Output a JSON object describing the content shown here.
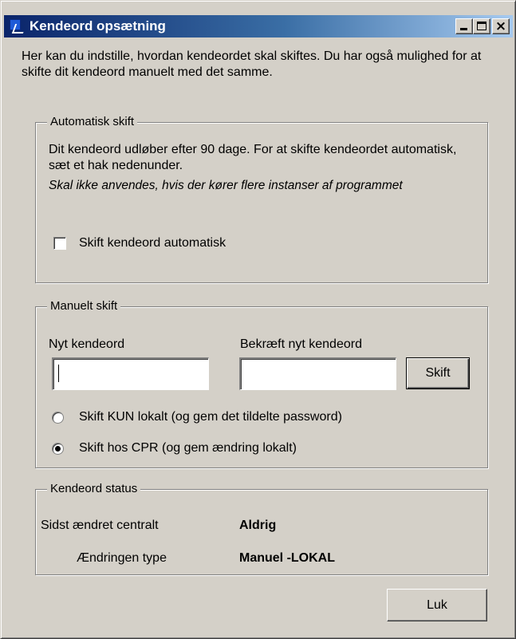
{
  "window": {
    "title": "Kendeord opsætning",
    "caption_minimize": "_",
    "caption_maximize": "□",
    "caption_close": "×"
  },
  "intro_text": "Her kan du indstille, hvordan kendeordet skal skiftes. Du har også mulighed for at skifte dit kendeord manuelt med det samme.",
  "automatic": {
    "legend": "Automatisk skift",
    "description": "Dit kendeord udløber efter 90 dage. For at skifte kendeordet automatisk, sæt et hak nedenunder.",
    "warning": "Skal ikke anvendes, hvis der kører flere instanser af programmet",
    "checkbox_label": "Skift kendeord automatisk",
    "checkbox_checked": false
  },
  "manual": {
    "legend": "Manuelt skift",
    "new_password_label": "Nyt kendeord",
    "new_password_value": "",
    "confirm_password_label": "Bekræft nyt kendeord",
    "confirm_password_value": "",
    "change_button": "Skift",
    "radio_local_label": "Skift KUN lokalt (og gem det tildelte password)",
    "radio_cpr_label": "Skift hos CPR (og gem ændring lokalt)",
    "selected_option": "cpr"
  },
  "status": {
    "legend": "Kendeord status",
    "last_changed_label": "Sidst ændret centralt",
    "last_changed_value": "Aldrig",
    "change_type_label": "Ændringen type",
    "change_type_value": "Manuel -LOKAL"
  },
  "close_button": "Luk"
}
